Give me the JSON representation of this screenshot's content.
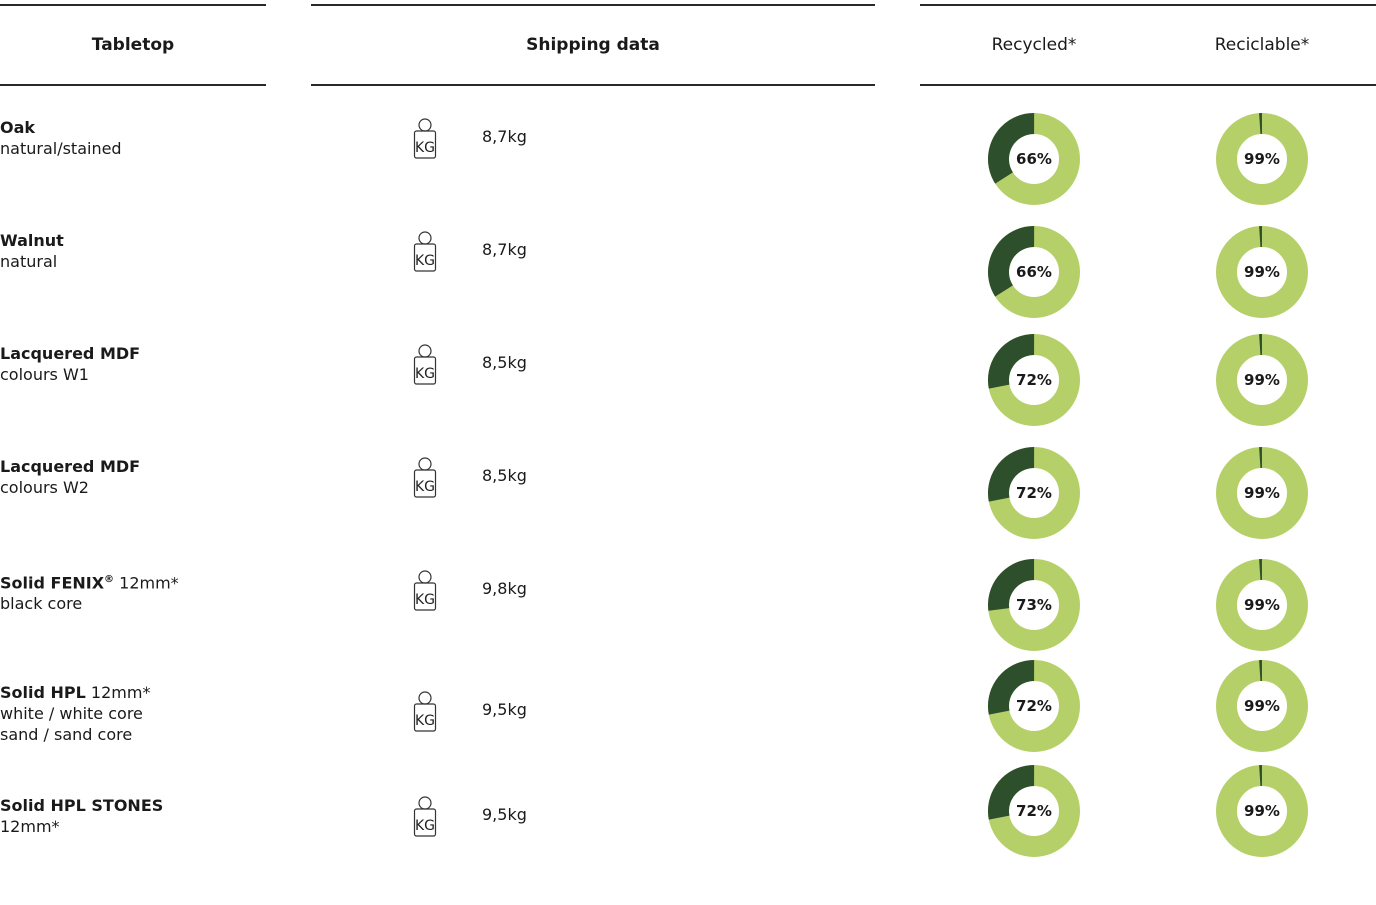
{
  "header": {
    "tabletop": "Tabletop",
    "shipping": "Shipping data",
    "recycled": "Recycled*",
    "reciclable": "Reciclable*"
  },
  "weight_icon_label": "KG",
  "colors": {
    "dark": "#2d4f2c",
    "light": "#b5d068"
  },
  "rows": [
    {
      "name": "Oak",
      "name_suffix": "",
      "spec": "",
      "sub": [
        "natural/stained"
      ],
      "weight": "8,7kg",
      "recycled": 66,
      "recycled_label": "66%",
      "recyclable": 99,
      "recyclable_label": "99%"
    },
    {
      "name": "Walnut",
      "name_suffix": "",
      "spec": "",
      "sub": [
        "natural"
      ],
      "weight": "8,7kg",
      "recycled": 66,
      "recycled_label": "66%",
      "recyclable": 99,
      "recyclable_label": "99%"
    },
    {
      "name": "Lacquered MDF",
      "name_suffix": "",
      "spec": "",
      "sub": [
        "colours W1"
      ],
      "weight": "8,5kg",
      "recycled": 72,
      "recycled_label": "72%",
      "recyclable": 99,
      "recyclable_label": "99%"
    },
    {
      "name": "Lacquered MDF",
      "name_suffix": "",
      "spec": "",
      "sub": [
        "colours W2"
      ],
      "weight": "8,5kg",
      "recycled": 72,
      "recycled_label": "72%",
      "recyclable": 99,
      "recyclable_label": "99%"
    },
    {
      "name": "Solid FENIX",
      "name_suffix": "®",
      "spec": "12mm*",
      "sub": [
        "black core"
      ],
      "weight": "9,8kg",
      "recycled": 73,
      "recycled_label": "73%",
      "recyclable": 99,
      "recyclable_label": "99%"
    },
    {
      "name": "Solid HPL",
      "name_suffix": "",
      "spec": "12mm*",
      "sub": [
        "white / white core",
        "sand / sand core"
      ],
      "weight": "9,5kg",
      "recycled": 72,
      "recycled_label": "72%",
      "recyclable": 99,
      "recyclable_label": "99%"
    },
    {
      "name": "Solid HPL STONES",
      "name_suffix": "",
      "spec": "",
      "sub": [
        "12mm*"
      ],
      "weight": "9,5kg",
      "recycled": 72,
      "recycled_label": "72%",
      "recyclable": 99,
      "recyclable_label": "99%"
    }
  ],
  "chart_data": {
    "type": "pie",
    "categories": [
      "Oak natural/stained",
      "Walnut natural",
      "Lacquered MDF colours W1",
      "Lacquered MDF colours W2",
      "Solid FENIX® 12mm* black core",
      "Solid HPL 12mm* white / white core sand / sand core",
      "Solid HPL STONES 12mm*"
    ],
    "series": [
      {
        "name": "Recycled*",
        "values": [
          66,
          66,
          72,
          72,
          73,
          72,
          72
        ]
      },
      {
        "name": "Reciclable*",
        "values": [
          99,
          99,
          99,
          99,
          99,
          99,
          99
        ]
      }
    ]
  }
}
